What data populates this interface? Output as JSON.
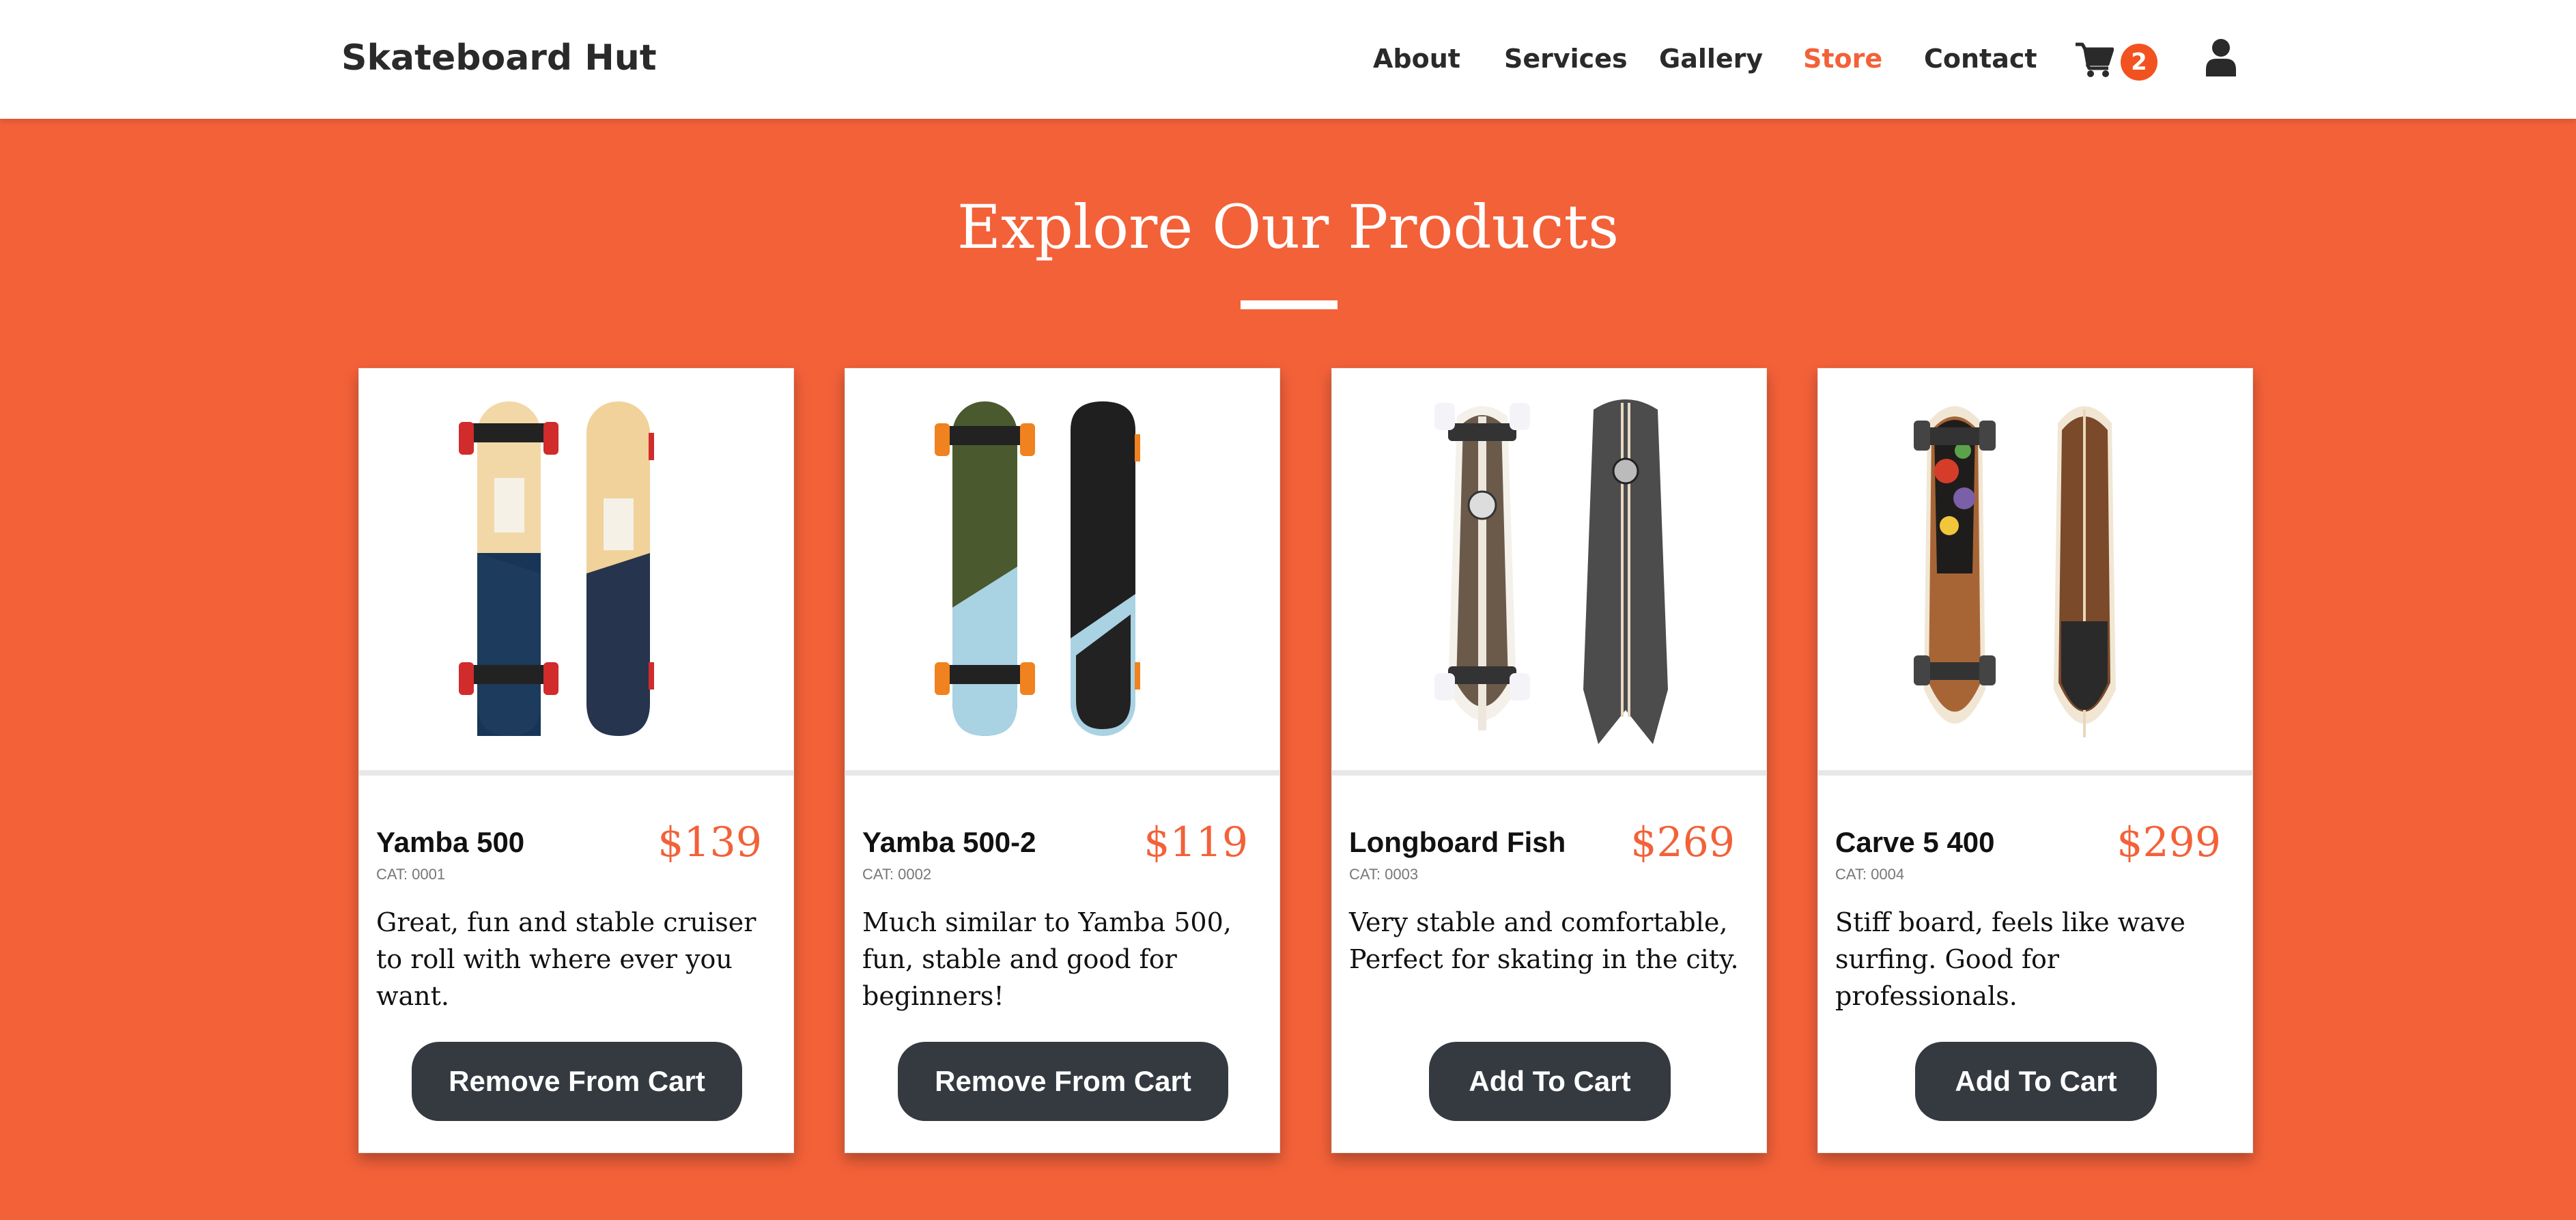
{
  "nav": {
    "brand": "Skateboard Hut",
    "links": [
      {
        "label": "About",
        "active": false
      },
      {
        "label": "Services",
        "active": false
      },
      {
        "label": "Gallery",
        "active": false
      },
      {
        "label": "Store",
        "active": true
      },
      {
        "label": "Contact",
        "active": false
      }
    ],
    "cart_count": "2",
    "cart_icon": "shopping-cart-icon",
    "user_icon": "user-icon"
  },
  "hero": {
    "title": "Explore Our Products"
  },
  "products": [
    {
      "name": "Yamba 500",
      "cat": "CAT: 0001",
      "price": "$139",
      "description": "Great, fun and stable cruiser to roll with where ever you want.",
      "button": "Remove From Cart"
    },
    {
      "name": "Yamba 500-2",
      "cat": "CAT: 0002",
      "price": "$119",
      "description": "Much similar to Yamba 500, fun, stable and good for beginners!",
      "button": "Remove From Cart"
    },
    {
      "name": "Longboard Fish",
      "cat": "CAT: 0003",
      "price": "$269",
      "description": "Very stable and comfortable, Perfect for skating in the city.",
      "button": "Add To Cart"
    },
    {
      "name": "Carve 5 400",
      "cat": "CAT: 0004",
      "price": "$299",
      "description": "Stiff board, feels like wave surfing. Good for professionals.",
      "button": "Add To Cart"
    }
  ],
  "colors": {
    "accent": "#f36139",
    "button": "#343a40",
    "badge": "#f2521f"
  }
}
